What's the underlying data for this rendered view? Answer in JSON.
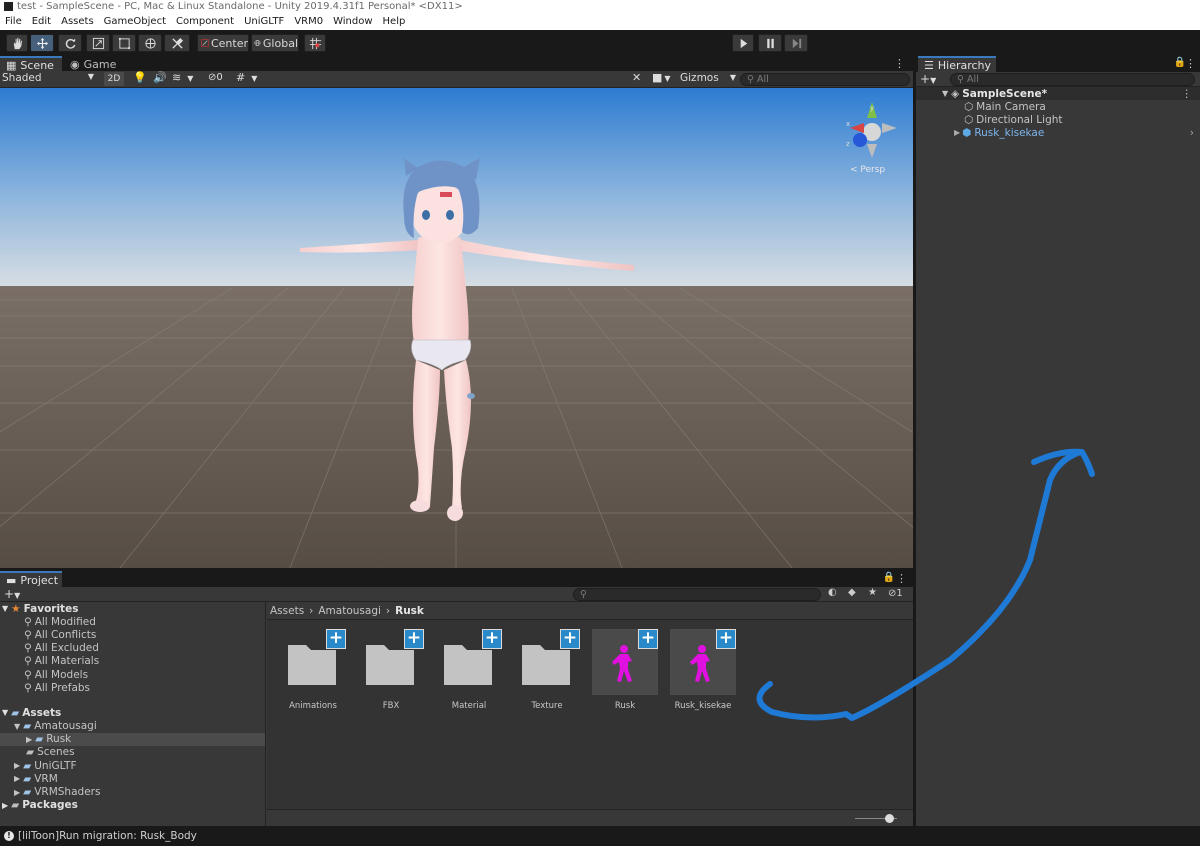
{
  "window": {
    "title": "test - SampleScene - PC, Mac & Linux Standalone - Unity 2019.4.31f1 Personal* <DX11>"
  },
  "menu": [
    "File",
    "Edit",
    "Assets",
    "GameObject",
    "Component",
    "UniGLTF",
    "VRM0",
    "Window",
    "Help"
  ],
  "toolbar": {
    "center_label": "Center",
    "global_label": "Global"
  },
  "scene": {
    "tabs": [
      "Scene",
      "Game"
    ],
    "shading_mode": "Shaded",
    "mode_2d": "2D",
    "hidden_count": "0",
    "gizmos_label": "Gizmos",
    "search_placeholder": "All",
    "persp_label": "< Persp",
    "gizmo_axes": {
      "x": "x",
      "y": "y",
      "z": "z"
    }
  },
  "hierarchy": {
    "tab": "Hierarchy",
    "search_placeholder": "All",
    "scene_name": "SampleScene*",
    "items": [
      "Main Camera",
      "Directional Light",
      "Rusk_kisekae"
    ]
  },
  "project": {
    "tab": "Project",
    "hidden_count": "1",
    "tree": {
      "favorites": "Favorites",
      "favorite_items": [
        "All Modified",
        "All Conflicts",
        "All Excluded",
        "All Materials",
        "All Models",
        "All Prefabs"
      ],
      "assets": "Assets",
      "amatousagi": "Amatousagi",
      "rusk": "Rusk",
      "asset_children": [
        "Scenes",
        "UniGLTF",
        "VRM",
        "VRMShaders"
      ],
      "packages": "Packages"
    },
    "breadcrumb": [
      "Assets",
      "Amatousagi",
      "Rusk"
    ],
    "assets": [
      {
        "name": "Animations",
        "kind": "folder"
      },
      {
        "name": "FBX",
        "kind": "folder"
      },
      {
        "name": "Material",
        "kind": "folder"
      },
      {
        "name": "Texture",
        "kind": "folder"
      },
      {
        "name": "Rusk",
        "kind": "prefab"
      },
      {
        "name": "Rusk_kisekae",
        "kind": "prefab"
      }
    ]
  },
  "status": {
    "message": "[lilToon]Run migration: Rusk_Body"
  },
  "colors": {
    "accent": "#3a79bb",
    "selection": "#46607c",
    "annotation": "#1f7ad6",
    "prefab_icon": "#e010e0"
  }
}
